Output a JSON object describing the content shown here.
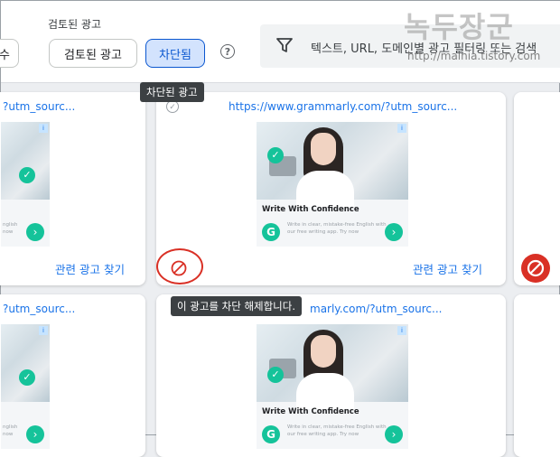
{
  "filters": {
    "section_label": "검토된 광고",
    "left_button_label": "수",
    "reviewed_button_label": "검토된 광고",
    "blocked_button_label": "차단됨",
    "help_icon": "help-circle-icon",
    "search_placeholder": "텍스트, URL, 도메인별 광고 필터링 또는 검색"
  },
  "watermark": {
    "title": "녹두장군",
    "url": "http://mainia.tistory.com"
  },
  "tooltips": {
    "blocked_ad": "차단된 광고",
    "unblock": "이 광고를 차단 해제합니다."
  },
  "ad": {
    "url_left": "?utm_sourc...",
    "url_full": "https://www.grammarly.com/?utm_sourc...",
    "url_partial": "marly.com/?utm_sourc...",
    "headline": "Write With Confidence",
    "description": "Write in clear, mistake-free English with our free writing app. Try now",
    "description_short": "nglish now",
    "brand_icon": "grammarly-g-icon",
    "cta_icon": "chevron-right-icon",
    "adchoices_icon": "adchoices-icon"
  },
  "card_actions": {
    "related_label": "관련 광고 찾기"
  },
  "colors": {
    "accent": "#1a73e8",
    "selected_bg": "#d3e3fd",
    "block_red": "#d93025",
    "grammarly_green": "#15c39a"
  }
}
